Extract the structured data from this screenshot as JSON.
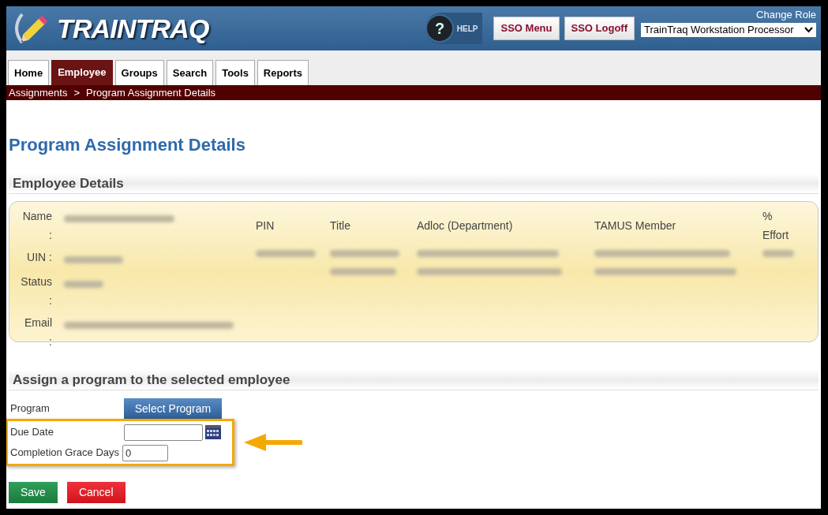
{
  "header": {
    "logo": "TRAINTRAQ",
    "help": "HELP",
    "help_glyph": "?",
    "buttons": [
      "SSO Menu",
      "SSO Logoff"
    ],
    "change_role": "Change Role",
    "role_select": {
      "value": "TrainTraq Workstation Processor"
    }
  },
  "tabs": [
    {
      "label": "Home",
      "selected": false
    },
    {
      "label": "Employee",
      "selected": true
    },
    {
      "label": "Groups",
      "selected": false
    },
    {
      "label": "Search",
      "selected": false
    },
    {
      "label": "Tools",
      "selected": false
    },
    {
      "label": "Reports",
      "selected": false
    }
  ],
  "breadcrumb": {
    "items": [
      "Assignments",
      "Program Assignment Details"
    ],
    "separator": ">"
  },
  "page_title": "Program Assignment Details",
  "employee_details": {
    "heading": "Employee Details",
    "fields": [
      {
        "label": "Name :",
        "value_lines": [
          {
            "kind": "blurred"
          }
        ]
      },
      {
        "label": "UIN :",
        "value_lines": [
          {
            "kind": "blurred"
          }
        ]
      },
      {
        "label": "Status :",
        "value_lines": [
          {
            "kind": "blurred"
          }
        ]
      },
      {
        "label": "Email :",
        "value_lines": [
          {
            "kind": "blurred"
          }
        ]
      }
    ],
    "columns": [
      {
        "label": "PIN",
        "value_lines": [
          {
            "kind": "blurred"
          }
        ]
      },
      {
        "label": "Title",
        "value_lines": [
          {
            "kind": "blurred"
          },
          {
            "kind": "blurred"
          }
        ]
      },
      {
        "label": "Adloc (Department)",
        "value_lines": [
          {
            "kind": "blurred"
          },
          {
            "kind": "blurred"
          }
        ]
      },
      {
        "label": "TAMUS Member",
        "value_lines": [
          {
            "kind": "blurred"
          },
          {
            "kind": "blurred"
          }
        ]
      },
      {
        "label": "% Effort",
        "value_lines": [
          {
            "kind": "blurred"
          }
        ]
      }
    ]
  },
  "assign": {
    "heading": "Assign a program to the selected employee",
    "rows": [
      {
        "label": "Program",
        "kind": "button",
        "text": "Select Program",
        "highlighted": false
      },
      {
        "label": "Due Date",
        "kind": "date",
        "value": "",
        "highlighted": true
      },
      {
        "label": "Completion Grace Days",
        "kind": "text",
        "value": "0",
        "highlighted": true
      }
    ],
    "buttons": [
      {
        "label": "Save",
        "kind": "primary"
      },
      {
        "label": "Cancel",
        "kind": "danger"
      }
    ]
  }
}
